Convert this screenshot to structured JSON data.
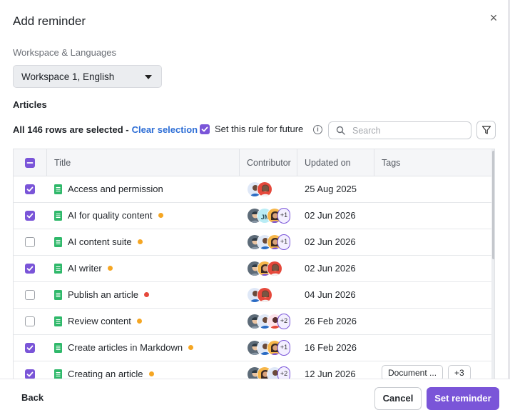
{
  "dialog": {
    "title": "Add reminder",
    "close_glyph": "×"
  },
  "workspace": {
    "label": "Workspace & Languages",
    "selected": "Workspace 1, English"
  },
  "articles": {
    "label": "Articles",
    "selection_text": "All 146 rows are selected -",
    "clear_selection": "Clear selection",
    "rule_label": "Set this rule for future",
    "rule_checked": true,
    "search_placeholder": "Search"
  },
  "table": {
    "columns": {
      "title": "Title",
      "contributor": "Contributor",
      "updated": "Updated on",
      "tags": "Tags"
    },
    "header_checkbox": "indeterminate",
    "rows": [
      {
        "checked": true,
        "title": "Access and permission",
        "status": "",
        "avatars": [
          "av-blue",
          "av-red"
        ],
        "more": "",
        "updated": "25 Aug 2025",
        "tags": []
      },
      {
        "checked": true,
        "title": "AI for quality content",
        "status": "orange",
        "avatars": [
          "av-grey",
          "av-jm",
          "av-orange"
        ],
        "more": "+1",
        "updated": "02 Jun 2026",
        "tags": []
      },
      {
        "checked": false,
        "title": "AI content suite",
        "status": "orange",
        "avatars": [
          "av-grey",
          "av-blue",
          "av-orange"
        ],
        "more": "+1",
        "updated": "02 Jun 2026",
        "tags": []
      },
      {
        "checked": true,
        "title": "AI writer",
        "status": "orange",
        "avatars": [
          "av-grey",
          "av-orange",
          "av-red"
        ],
        "more": "",
        "updated": "02 Jun 2026",
        "tags": []
      },
      {
        "checked": false,
        "title": "Publish an article",
        "status": "red",
        "avatars": [
          "av-blue",
          "av-red"
        ],
        "more": "",
        "updated": "04 Jun 2026",
        "tags": []
      },
      {
        "checked": false,
        "title": "Review content",
        "status": "orange",
        "avatars": [
          "av-grey",
          "av-blue",
          "av-pink"
        ],
        "more": "+2",
        "updated": "26 Feb 2026",
        "tags": []
      },
      {
        "checked": true,
        "title": "Create articles in Markdown",
        "status": "orange",
        "avatars": [
          "av-grey",
          "av-blue",
          "av-orange"
        ],
        "more": "+1",
        "updated": "16 Feb 2026",
        "tags": []
      },
      {
        "checked": true,
        "title": "Creating an article",
        "status": "orange",
        "avatars": [
          "av-grey",
          "av-orange",
          "av-blue"
        ],
        "more": "+2",
        "updated": "12 Jun 2026",
        "tags": [
          "Document ...",
          "+3"
        ]
      }
    ]
  },
  "colors": {
    "accent": "#7a55d8",
    "link": "#2f6fd6",
    "status_orange": "#f5a623",
    "status_red": "#e5483b",
    "doc_green": "#2fb86a"
  },
  "footer": {
    "back": "Back",
    "cancel": "Cancel",
    "primary": "Set reminder"
  }
}
